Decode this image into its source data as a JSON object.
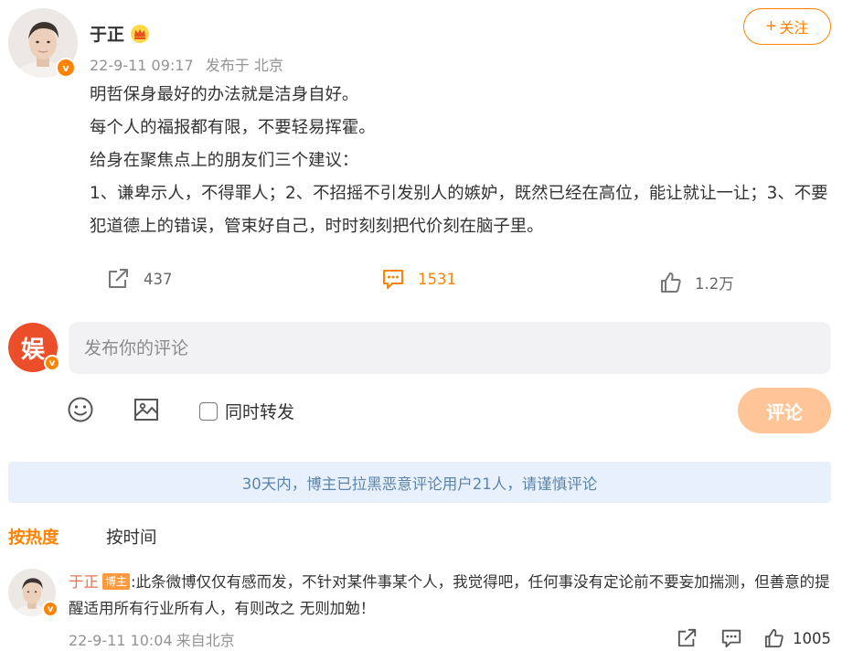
{
  "post": {
    "author": "于正",
    "time": "22-9-11 09:17",
    "location": "发布于 北京",
    "follow_label": "关注",
    "follow_plus": "+",
    "lines": [
      "明哲保身最好的办法就是洁身自好。",
      "每个人的福报都有限，不要轻易挥霍。",
      "给身在聚焦点上的朋友们三个建议：",
      "1、谦卑示人，不得罪人；2、不招摇不引发别人的嫉妒，既然已经在高位，能让就让一让；3、不要犯道德上的错误，管束好自己，时时刻刻把代价刻在脑子里。"
    ],
    "repost_count": "437",
    "comment_count": "1531",
    "like_count": "1.2万",
    "verified_badge": "v"
  },
  "composer": {
    "placeholder": "发布你的评论",
    "repost_label": "同时转发",
    "submit_label": "评论",
    "avatar_glyph": "娱"
  },
  "notice": "30天内，博主已拉黑恶意评论用户21人，请谨慎评论",
  "sort": {
    "hot": "按热度",
    "time": "按时间"
  },
  "comment": {
    "name": "于正",
    "tag": "博主",
    "text": ":此条微博仅仅有感而发，不针对某件事某个人，我觉得吧，任何事没有定论前不要妄加揣测，但善意的提醒适用所有行业所有人，有则改之 无则加勉！",
    "time": "22-9-11 10:04",
    "source": "来自北京",
    "like_count": "1005"
  },
  "colors": {
    "accent": "#ff8200",
    "submit_disabled": "#ffc596",
    "notice_bg": "#e8f1fb",
    "notice_text": "#5b84ad",
    "comment_name": "#eb7350"
  },
  "icons": [
    "crown-icon",
    "repost-icon",
    "comment-icon",
    "like-icon",
    "emoji-icon",
    "image-icon",
    "verified-icon"
  ]
}
